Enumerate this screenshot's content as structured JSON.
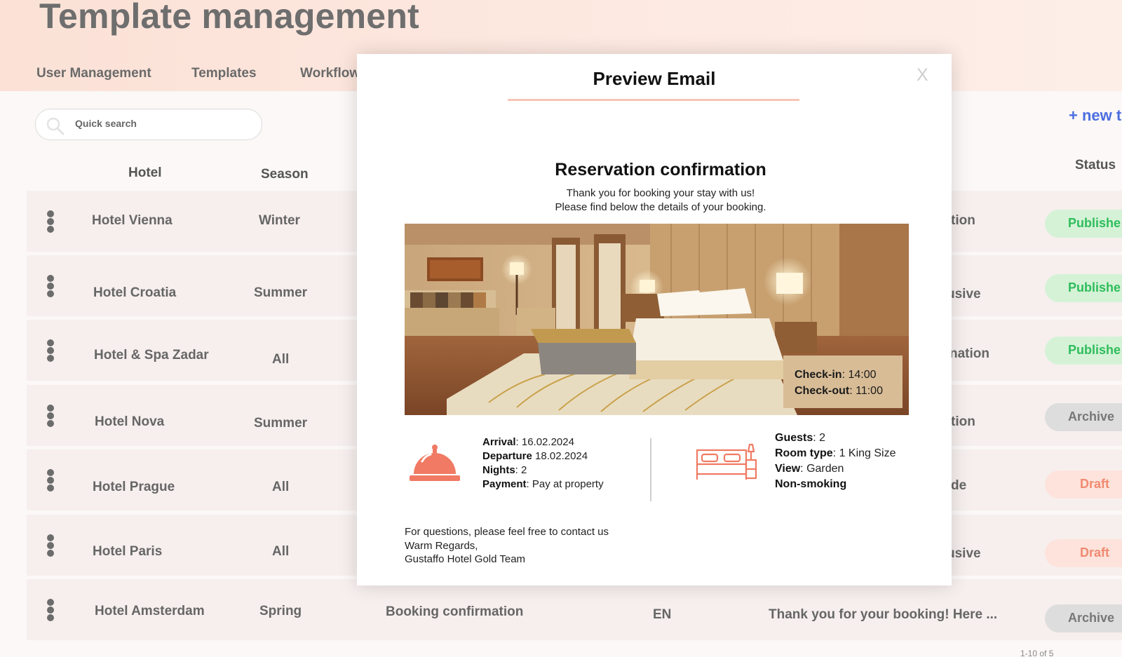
{
  "page": {
    "title": "Template management"
  },
  "nav": {
    "tabs": [
      {
        "label": "User Management"
      },
      {
        "label": "Templates"
      },
      {
        "label": "Workflow"
      }
    ]
  },
  "toolbar": {
    "search_placeholder": "Quick search",
    "new_button_label": "+ new t"
  },
  "table": {
    "headers": {
      "hotel": "Hotel",
      "season": "Season",
      "status": "Status"
    },
    "rows": [
      {
        "hotel": "Hotel  Vienna",
        "season": "Winter",
        "type": "tion",
        "status": "Publishe",
        "status_kind": "published"
      },
      {
        "hotel": "Hotel Croatia",
        "season": "Summer",
        "type": "usive",
        "status": "Publishe",
        "status_kind": "published"
      },
      {
        "hotel": "Hotel & Spa Zadar",
        "season": "All",
        "type": "nation",
        "status": "Publishe",
        "status_kind": "published"
      },
      {
        "hotel": "Hotel Nova",
        "season": "Summer",
        "type": "tion",
        "status": "Archive",
        "status_kind": "archived"
      },
      {
        "hotel": "Hotel  Prague",
        "season": "All",
        "type": "de",
        "status": "Draft",
        "status_kind": "draft"
      },
      {
        "hotel": "Hotel  Paris",
        "season": "All",
        "type": "usive",
        "status": "Draft",
        "status_kind": "draft"
      },
      {
        "hotel": "Hotel  Amsterdam",
        "season": "Spring",
        "template": "Booking confirmation",
        "language": "EN",
        "preview": "Thank you for your booking! Here ...",
        "status": "Archive",
        "status_kind": "archived"
      }
    ],
    "pagination": "1-10 of 5"
  },
  "modal": {
    "title": "Preview Email",
    "close_label": "X",
    "email": {
      "heading": "Reservation confirmation",
      "intro_line1": "Thank you for booking your stay with us!",
      "intro_line2": "Please find below the details of your booking.",
      "checkin_label": "Check-in",
      "checkin_value": ": 14:00",
      "checkout_label": "Check-out",
      "checkout_value": ": 11:00",
      "arrival_label": "Arrival",
      "arrival_value": ": 16.02.2024",
      "departure_label": "Departure",
      "departure_value": " 18.02.2024",
      "nights_label": "Nights",
      "nights_value": ": 2",
      "payment_label": "Payment",
      "payment_value": ": Pay at property",
      "guests_label": "Guests",
      "guests_value": ": 2",
      "roomtype_label": "Room type",
      "roomtype_value": ": 1 King Size",
      "view_label": "View",
      "view_value": ": Garden",
      "nonsmoking_label": "Non-smoking",
      "footer_line1": "For questions, please feel free to contact us",
      "footer_line2": "Warm Regards,",
      "footer_line3": "Gustaffo Hotel Gold Team"
    }
  },
  "colors": {
    "accent": "#f07a63",
    "link": "#4c6ee0",
    "published": "#2fbd5c",
    "draft": "#f08a70"
  }
}
